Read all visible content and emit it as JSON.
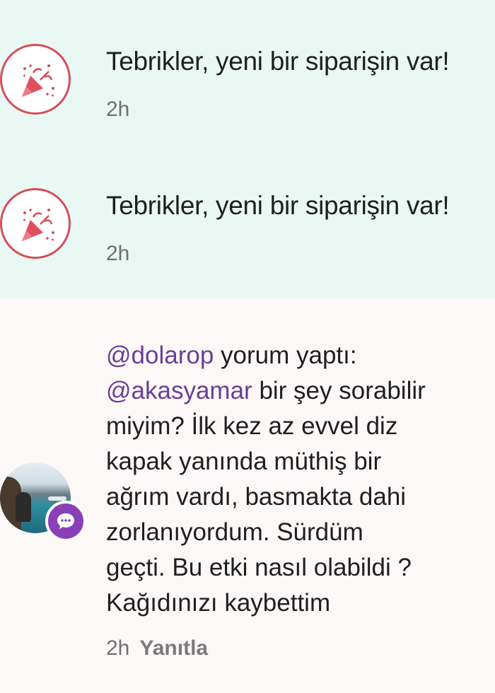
{
  "notifications": [
    {
      "icon": "party-popper-icon",
      "text": "Tebrikler, yeni bir siparişin var!",
      "time": "2h"
    },
    {
      "icon": "party-popper-icon",
      "text": "Tebrikler, yeni bir siparişin var!",
      "time": "2h"
    }
  ],
  "comment": {
    "user": "@dolarop",
    "action": "yorum yaptı:",
    "mention": "@akasyamar",
    "line2_rest": "bir şey sorabilir",
    "line3": "miyim? İlk kez az evvel diz",
    "line4": "kapak yanında müthiş bir",
    "line5": "ağrım vardı, basmakta dahi",
    "line6": "zorlanıyordum. Sürdüm",
    "line7": "geçti. Bu etki nasıl olabildi ?",
    "line8": "Kağıdınızı kaybettim",
    "time": "2h",
    "reply_label": "Yanıtla"
  },
  "colors": {
    "notification_bg": "#eaf8f3",
    "icon_accent": "#d44e5a",
    "mention": "#6a3f94",
    "comment_badge": "#8a3fb8"
  }
}
